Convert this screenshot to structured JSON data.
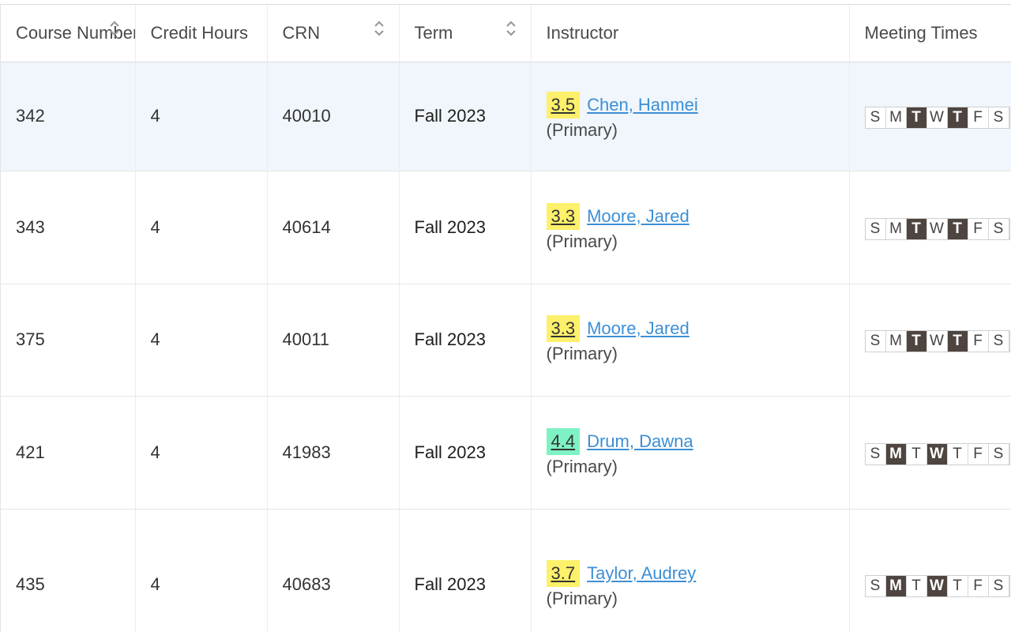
{
  "columns": [
    {
      "label": "Course Number",
      "sortable": true
    },
    {
      "label": "Credit Hours",
      "sortable": false
    },
    {
      "label": "CRN",
      "sortable": true
    },
    {
      "label": "Term",
      "sortable": true
    },
    {
      "label": "Instructor",
      "sortable": false
    },
    {
      "label": "Meeting Times",
      "sortable": false
    }
  ],
  "colors": {
    "rating_yellow": "#fdf06b",
    "rating_green": "#7ff2c4",
    "link_blue": "#3d8fd6",
    "day_active": "#4e4540",
    "row_highlight": "#f0f6fb"
  },
  "rows": [
    {
      "course": "342",
      "credits": "4",
      "crn": "40010",
      "term": "Fall 2023",
      "rating": "3.5",
      "rating_color": "#fdf06b",
      "instructor": "Chen, Hanmei",
      "role": "(Primary)",
      "highlighted": true,
      "days": [
        {
          "d": "S",
          "on": false
        },
        {
          "d": "M",
          "on": false
        },
        {
          "d": "T",
          "on": true
        },
        {
          "d": "W",
          "on": false
        },
        {
          "d": "T",
          "on": true
        },
        {
          "d": "F",
          "on": false
        },
        {
          "d": "S",
          "on": false
        }
      ]
    },
    {
      "course": "343",
      "credits": "4",
      "crn": "40614",
      "term": "Fall 2023",
      "rating": "3.3",
      "rating_color": "#fdf06b",
      "instructor": "Moore, Jared",
      "role": "(Primary)",
      "highlighted": false,
      "days": [
        {
          "d": "S",
          "on": false
        },
        {
          "d": "M",
          "on": false
        },
        {
          "d": "T",
          "on": true
        },
        {
          "d": "W",
          "on": false
        },
        {
          "d": "T",
          "on": true
        },
        {
          "d": "F",
          "on": false
        },
        {
          "d": "S",
          "on": false
        }
      ]
    },
    {
      "course": "375",
      "credits": "4",
      "crn": "40011",
      "term": "Fall 2023",
      "rating": "3.3",
      "rating_color": "#fdf06b",
      "instructor": "Moore, Jared",
      "role": "(Primary)",
      "highlighted": false,
      "days": [
        {
          "d": "S",
          "on": false
        },
        {
          "d": "M",
          "on": false
        },
        {
          "d": "T",
          "on": true
        },
        {
          "d": "W",
          "on": false
        },
        {
          "d": "T",
          "on": true
        },
        {
          "d": "F",
          "on": false
        },
        {
          "d": "S",
          "on": false
        }
      ]
    },
    {
      "course": "421",
      "credits": "4",
      "crn": "41983",
      "term": "Fall 2023",
      "rating": "4.4",
      "rating_color": "#7ff2c4",
      "instructor": "Drum, Dawna",
      "role": "(Primary)",
      "highlighted": false,
      "days": [
        {
          "d": "S",
          "on": false
        },
        {
          "d": "M",
          "on": true
        },
        {
          "d": "T",
          "on": false
        },
        {
          "d": "W",
          "on": true
        },
        {
          "d": "T",
          "on": false
        },
        {
          "d": "F",
          "on": false
        },
        {
          "d": "S",
          "on": false
        }
      ]
    },
    {
      "course": "435",
      "credits": "4",
      "crn": "40683",
      "term": "Fall 2023",
      "rating": "3.7",
      "rating_color": "#fdf06b",
      "instructor": "Taylor, Audrey",
      "role": "(Primary)",
      "highlighted": false,
      "days": [
        {
          "d": "S",
          "on": false
        },
        {
          "d": "M",
          "on": true
        },
        {
          "d": "T",
          "on": false
        },
        {
          "d": "W",
          "on": true
        },
        {
          "d": "T",
          "on": false
        },
        {
          "d": "F",
          "on": false
        },
        {
          "d": "S",
          "on": false
        }
      ]
    }
  ]
}
